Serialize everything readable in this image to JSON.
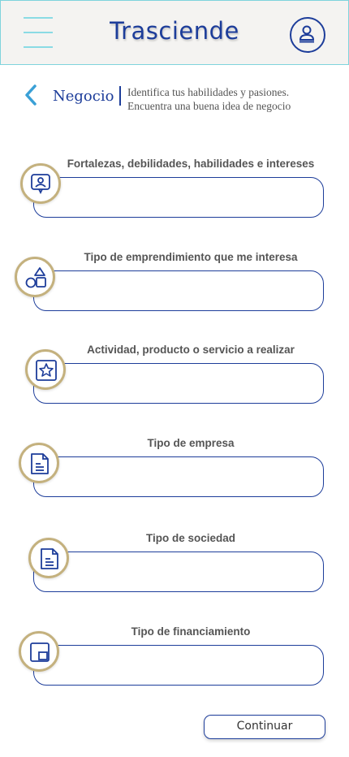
{
  "header": {
    "app_title": "Trasciende",
    "menu_icon": "hamburger-icon",
    "profile_icon": "user-icon"
  },
  "section": {
    "back_icon": "chevron-left-icon",
    "title": "Negocio",
    "description_line1": "Identifica tus habilidades y pasiones.",
    "description_line2": "Encuentra una buena idea de negocio"
  },
  "fields": [
    {
      "label": "Fortalezas, debilidades, habilidades e intereses",
      "icon": "profile-card-icon",
      "value": ""
    },
    {
      "label": "Tipo de emprendimiento que me interesa",
      "icon": "shapes-icon",
      "value": ""
    },
    {
      "label": "Actividad, producto o servicio a realizar",
      "icon": "star-badge-icon",
      "value": ""
    },
    {
      "label": "Tipo de empresa",
      "icon": "document-icon",
      "value": ""
    },
    {
      "label": "Tipo de sociedad",
      "icon": "document-icon",
      "value": ""
    },
    {
      "label": "Tipo de financiamiento",
      "icon": "picture-in-picture-icon",
      "value": ""
    }
  ],
  "actions": {
    "continue_label": "Continuar"
  },
  "colors": {
    "primary": "#1d3d9a",
    "accent": "#c4b17e",
    "header_border": "#7fd3dc"
  }
}
